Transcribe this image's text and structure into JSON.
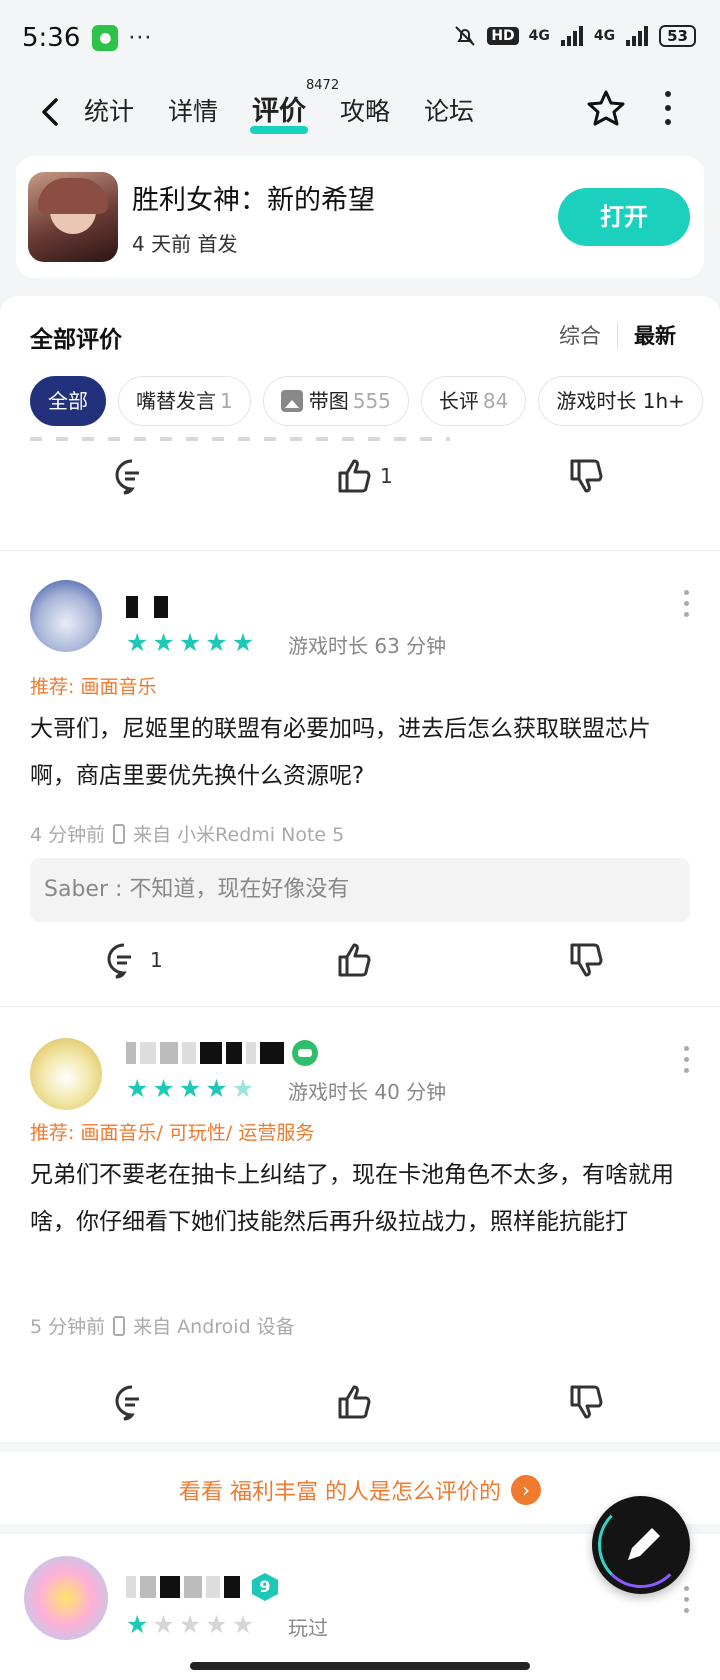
{
  "status_bar": {
    "time": "5:36",
    "more": "···",
    "hd": "HD",
    "net1": "4G",
    "net2": "4G",
    "battery": "53"
  },
  "nav": {
    "tabs": [
      {
        "label": "统计"
      },
      {
        "label": "详情"
      },
      {
        "label": "评价"
      },
      {
        "label": "攻略"
      },
      {
        "label": "论坛"
      }
    ],
    "review_count": "8472"
  },
  "app": {
    "title": "胜利女神：新的希望",
    "subtitle": "4 天前 首发",
    "open_label": "打开"
  },
  "reviews_section": {
    "title": "全部评价",
    "sort_options": [
      "综合",
      "最新"
    ],
    "chips": [
      {
        "label": "全部",
        "count": ""
      },
      {
        "label": "嘴替发言",
        "count": "1"
      },
      {
        "label": "带图",
        "count": "555"
      },
      {
        "label": "长评",
        "count": "84"
      },
      {
        "label": "游戏时长 1h+",
        "count": ""
      }
    ]
  },
  "top_actions": {
    "like_count": "1"
  },
  "reviews": [
    {
      "rating": 5,
      "playtime": "游戏时长 63 分钟",
      "recommend": "推荐: 画面音乐",
      "text": "大哥们，尼姬里的联盟有必要加吗，进去后怎么获取联盟芯片啊，商店里要优先换什么资源呢?",
      "time": "4 分钟前",
      "device": "来自 小米Redmi Note 5",
      "reply": "Saber : 不知道，现在好像没有",
      "comment_count": "1"
    },
    {
      "rating": 5,
      "playtime": "游戏时长 40 分钟",
      "recommend": "推荐: 画面音乐/ 可玩性/ 运营服务",
      "text": "兄弟们不要老在抽卡上纠结了，现在卡池角色不太多，有啥就用啥，你仔细看下她们技能然后再升级拉战力，照样能抗能打",
      "time": "5 分钟前",
      "device": "来自 Android 设备"
    },
    {
      "rating": 1,
      "playtime": "玩过",
      "level": "9"
    }
  ],
  "promo": {
    "text": "看看 福利丰富 的人是怎么评价的",
    "arrow": "›"
  },
  "colors": {
    "accent": "#1bd1bd",
    "chip_active": "#23317d",
    "orange": "#f07a2e"
  }
}
